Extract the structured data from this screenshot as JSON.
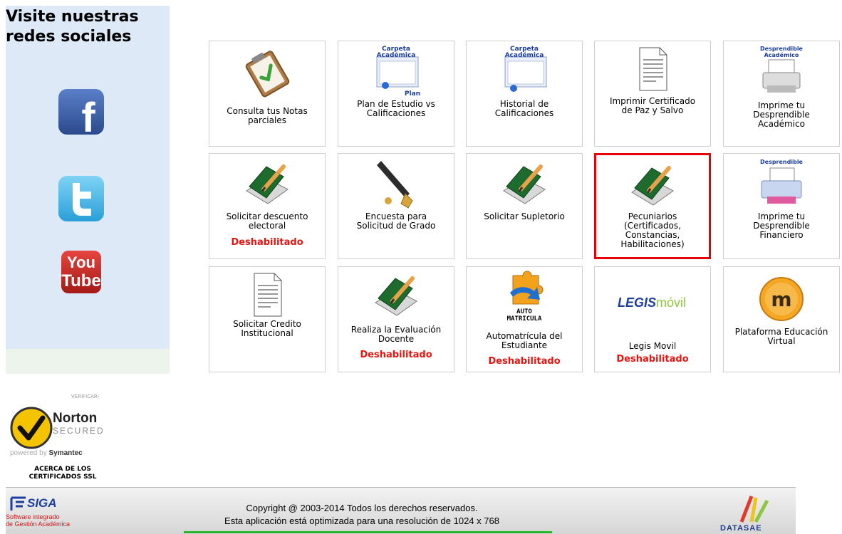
{
  "sidebar": {
    "title_line1": "Visite nuestras",
    "title_line2": "redes sociales",
    "social": [
      {
        "name": "facebook-icon",
        "text": "f"
      },
      {
        "name": "twitter-icon",
        "text": "t"
      },
      {
        "name": "youtube-icon",
        "text_top": "You",
        "text_bottom": "Tube"
      }
    ]
  },
  "tiles": [
    {
      "label_lines": [
        "Consulta tus Notas",
        "parciales"
      ],
      "icon": "clipboard-check-icon",
      "disabled": ""
    },
    {
      "label_lines": [
        "Plan de Estudio vs",
        "Calificaciones"
      ],
      "icon": "academic-folder-plan-icon",
      "icon_top": "Carpeta",
      "icon_mid": "Académica",
      "icon_sub": "Plan",
      "disabled": ""
    },
    {
      "label_lines": [
        "Historial de",
        "Calificaciones"
      ],
      "icon": "academic-folder-history-icon",
      "icon_top": "Carpeta",
      "icon_mid": "Académica",
      "disabled": ""
    },
    {
      "label_lines": [
        "Imprimir Certificado",
        "de Paz y Salvo"
      ],
      "icon": "document-icon",
      "disabled": ""
    },
    {
      "label_lines": [
        "Imprime tu",
        "Desprendible",
        "Académico"
      ],
      "icon": "printer-academic-icon",
      "icon_top": "Desprendible",
      "icon_mid": "Académico",
      "disabled": ""
    },
    {
      "label_lines": [
        "Solicitar descuento",
        "electoral"
      ],
      "icon": "book-pencil-icon",
      "disabled": "Deshabilitado"
    },
    {
      "label_lines": [
        "Encuesta para",
        "Solicitud de Grado"
      ],
      "icon": "fountain-pen-icon",
      "disabled": ""
    },
    {
      "label_lines": [
        "Solicitar Supletorio"
      ],
      "icon": "book-pencil-icon",
      "disabled": ""
    },
    {
      "label_lines": [
        "Pecuniarios",
        "(Certificados,",
        "Constancias,",
        "Habilitaciones)"
      ],
      "icon": "book-pencil-icon",
      "disabled": ""
    },
    {
      "label_lines": [
        "Imprime tu",
        "Desprendible",
        "Financiero"
      ],
      "icon": "printer-financial-icon",
      "icon_top": "Desprendible",
      "disabled": ""
    },
    {
      "label_lines": [
        "Solicitar Credito",
        "Institucional"
      ],
      "icon": "document-icon",
      "disabled": ""
    },
    {
      "label_lines": [
        "Realiza la Evaluación",
        "Docente"
      ],
      "icon": "book-pencil-icon",
      "disabled": "Deshabilitado"
    },
    {
      "label_lines": [
        "Automatrícula del",
        "Estudiante"
      ],
      "icon": "puzzle-arrow-icon",
      "icon_top": "AUTO",
      "icon_mid": "MATRICULA",
      "disabled": "Deshabilitado"
    },
    {
      "label_lines": [
        "Legis Movil"
      ],
      "icon": "legis-movil-logo",
      "icon_top": "LEGIS",
      "icon_mid": "móvil",
      "disabled": "Deshabilitado"
    },
    {
      "label_lines": [
        "Plataforma Educación",
        "Virtual"
      ],
      "icon": "moodle-icon",
      "disabled": ""
    }
  ],
  "norton": {
    "verify": "VERIFICAR›",
    "word": "Norton",
    "secured": "SECURED",
    "powered_prefix": "powered by",
    "powered_brand": "Symantec",
    "ssl_line1": "ACERCA DE LOS",
    "ssl_line2": "CERTIFICADOS SSL"
  },
  "footer": {
    "copyright": "Copyright @ 2003-2014 Todos los derechos reservados.",
    "resolution": "Esta aplicación está optimizada para una resolución de 1024 x 768",
    "siga_word": "SIGA",
    "siga_sub1": "Software integrado",
    "siga_sub2": "de Gestión Académica",
    "datasae": "DATASAE"
  },
  "colors": {
    "sidebar_bg": "#dde9f7",
    "disabled_text": "#e8140f",
    "highlight_border": "#e8000b",
    "footer_line": "#2db52d"
  }
}
